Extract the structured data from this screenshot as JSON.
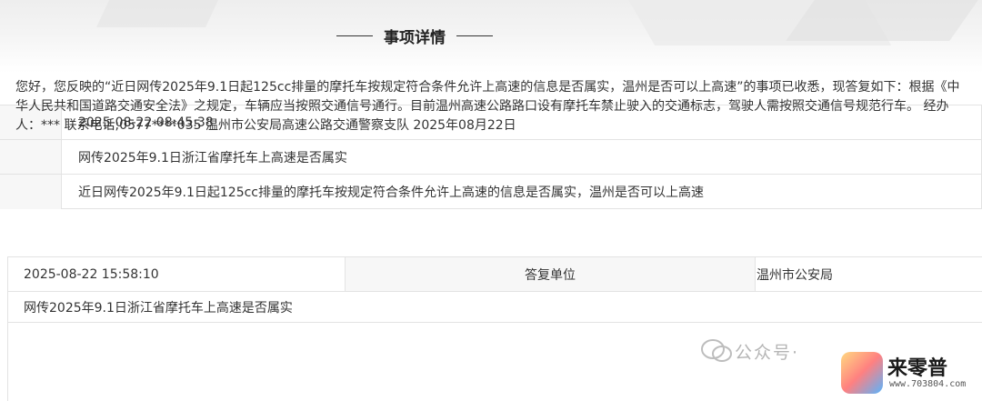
{
  "section_title": "事项详情",
  "request": {
    "time": "2025-08-22 08:45:38",
    "subject": "网传2025年9.1日浙江省摩托车上高速是否属实",
    "content": "近日网传2025年9.1日起125cc排量的摩托车按规定符合条件允许上高速的信息是否属实，温州是否可以上高速"
  },
  "reply": {
    "time": "2025-08-22 15:58:10",
    "unit_label": "答复单位",
    "unit": "温州市公安局",
    "subject": "网传2025年9.1日浙江省摩托车上高速是否属实",
    "body": "您好，您反映的“近日网传2025年9.1日起125cc排量的摩托车按规定符合条件允许上高速的信息是否属实，温州是否可以上高速”的事项已收悉，现答复如下：根据《中华人民共和国道路交通安全法》之规定，车辆应当按照交通信号通行。目前温州高速公路路口设有摩托车禁止驶入的交通标志，驾驶人需按照交通信号规范行车。 经办人：*** 联系电话;0577****035 温州市公安局高速公路交通警察支队 2025年08月22日"
  },
  "watermark": {
    "text": "公众号·",
    "brand": "来零普",
    "url": "www.703804.com"
  }
}
